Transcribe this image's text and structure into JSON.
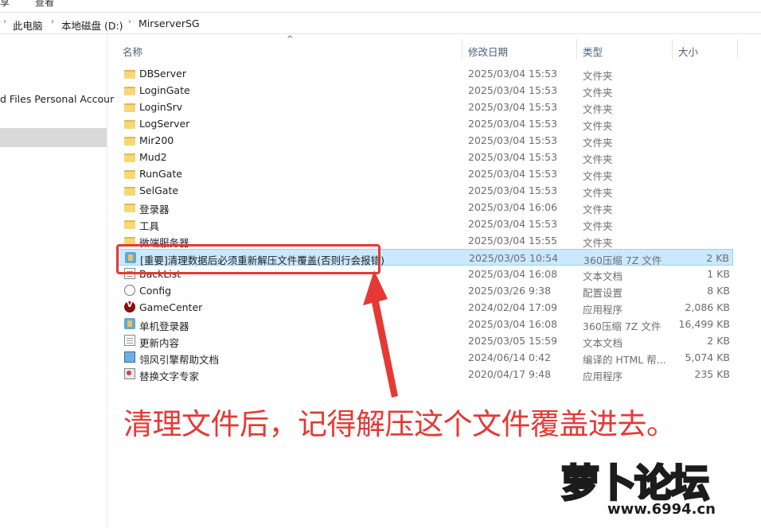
{
  "ribbon": {
    "tab1": "享",
    "tab2": "查看"
  },
  "address": {
    "seg1": "此电脑",
    "seg2": "本地磁盘 (D:)",
    "seg3": "MirserverSG"
  },
  "nav": {
    "partial_text": "d Files Personal Accour"
  },
  "columns": {
    "name": "名称",
    "date": "修改日期",
    "type": "类型",
    "size": "大小"
  },
  "files": [
    {
      "name": "DBServer",
      "date": "2025/03/04 15:53",
      "type": "文件夹",
      "size": "",
      "icon": "folder-icon"
    },
    {
      "name": "LoginGate",
      "date": "2025/03/04 15:53",
      "type": "文件夹",
      "size": "",
      "icon": "folder-icon"
    },
    {
      "name": "LoginSrv",
      "date": "2025/03/04 15:53",
      "type": "文件夹",
      "size": "",
      "icon": "folder-icon"
    },
    {
      "name": "LogServer",
      "date": "2025/03/04 15:53",
      "type": "文件夹",
      "size": "",
      "icon": "folder-icon"
    },
    {
      "name": "Mir200",
      "date": "2025/03/04 15:53",
      "type": "文件夹",
      "size": "",
      "icon": "folder-icon"
    },
    {
      "name": "Mud2",
      "date": "2025/03/04 15:53",
      "type": "文件夹",
      "size": "",
      "icon": "folder-icon"
    },
    {
      "name": "RunGate",
      "date": "2025/03/04 15:53",
      "type": "文件夹",
      "size": "",
      "icon": "folder-icon"
    },
    {
      "name": "SelGate",
      "date": "2025/03/04 15:53",
      "type": "文件夹",
      "size": "",
      "icon": "folder-icon"
    },
    {
      "name": "登录器",
      "date": "2025/03/04 16:06",
      "type": "文件夹",
      "size": "",
      "icon": "folder-icon"
    },
    {
      "name": "工具",
      "date": "2025/03/04 15:53",
      "type": "文件夹",
      "size": "",
      "icon": "folder-icon"
    },
    {
      "name": "微端服务器",
      "date": "2025/03/04 15:55",
      "type": "文件夹",
      "size": "",
      "icon": "folder-icon"
    },
    {
      "name": "[重要]清理数据后必须重新解压文件覆盖(否则行会报错)",
      "date": "2025/03/05 10:54",
      "type": "360压缩 7Z 文件",
      "size": "2 KB",
      "icon": "archive-icon",
      "selected": true
    },
    {
      "name": "BackList",
      "date": "2025/03/04 16:08",
      "type": "文本文档",
      "size": "1 KB",
      "icon": "text-file-icon"
    },
    {
      "name": "Config",
      "date": "2025/03/26 9:38",
      "type": "配置设置",
      "size": "8 KB",
      "icon": "config-file-icon"
    },
    {
      "name": "GameCenter",
      "date": "2024/02/04 17:09",
      "type": "应用程序",
      "size": "2,086 KB",
      "icon": "game-app-icon"
    },
    {
      "name": "单机登录器",
      "date": "2025/03/04 16:08",
      "type": "360压缩 7Z 文件",
      "size": "16,499 KB",
      "icon": "archive-icon"
    },
    {
      "name": "更新内容",
      "date": "2025/03/05 15:59",
      "type": "文本文档",
      "size": "2 KB",
      "icon": "text-file-icon"
    },
    {
      "name": "翎风引擎帮助文档",
      "date": "2024/06/14 0:42",
      "type": "编译的 HTML 帮...",
      "size": "5,074 KB",
      "icon": "chm-help-icon"
    },
    {
      "name": "替换文字专家",
      "date": "2020/04/17 9:48",
      "type": "应用程序",
      "size": "235 KB",
      "icon": "app-icon"
    }
  ],
  "annotation": {
    "caption": "清理文件后，记得解压这个文件覆盖进去。",
    "color": "#e53935"
  },
  "watermark": {
    "logo_text": "萝卜论坛",
    "url": "www.6994.cn"
  }
}
